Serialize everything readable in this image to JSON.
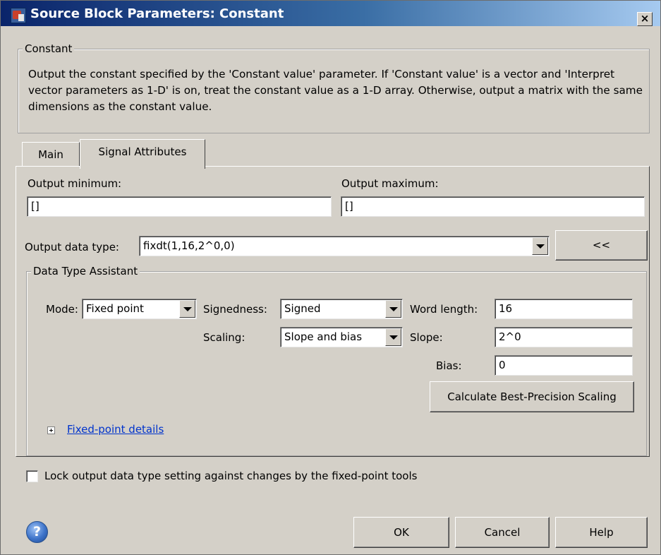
{
  "window": {
    "title": "Source Block Parameters: Constant",
    "close_label": "×"
  },
  "description": {
    "legend": "Constant",
    "text": "Output the constant specified by the 'Constant value' parameter. If 'Constant value' is a vector and 'Interpret vector parameters as 1-D' is on, treat the constant value as a 1-D array. Otherwise, output a matrix with the same dimensions as the constant value."
  },
  "tabs": [
    {
      "label": "Main",
      "active": false
    },
    {
      "label": "Signal Attributes",
      "active": true
    }
  ],
  "signal_attributes": {
    "output_min_label": "Output minimum:",
    "output_min_value": "[]",
    "output_max_label": "Output maximum:",
    "output_max_value": "[]",
    "data_type_label": "Output data type:",
    "data_type_value": "fixdt(1,16,2^0,0)",
    "assistant_toggle_label": "<<"
  },
  "assistant": {
    "legend": "Data Type Assistant",
    "mode_label": "Mode:",
    "mode_value": "Fixed point",
    "signedness_label": "Signedness:",
    "signedness_value": "Signed",
    "scaling_label": "Scaling:",
    "scaling_value": "Slope and bias",
    "word_length_label": "Word length:",
    "word_length_value": "16",
    "slope_label": "Slope:",
    "slope_value": "2^0",
    "bias_label": "Bias:",
    "bias_value": "0",
    "calc_button_label": "Calculate Best-Precision Scaling",
    "details_link": "Fixed-point details"
  },
  "lock_checkbox": {
    "label": "Lock output data type setting against changes by the fixed-point tools",
    "checked": false
  },
  "footer": {
    "help_icon_glyph": "?",
    "ok_label": "OK",
    "cancel_label": "Cancel",
    "help_label": "Help"
  },
  "colors": {
    "dialog_bg": "#d4d0c8",
    "title_gradient_start": "#0a246a",
    "title_gradient_end": "#a6caf0",
    "link": "#0033cc"
  }
}
